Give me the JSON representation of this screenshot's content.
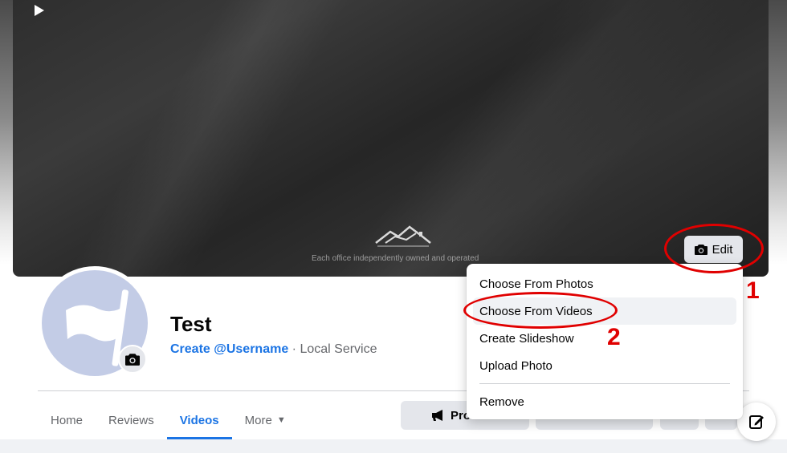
{
  "cover": {
    "caption": "Each office independently owned and operated",
    "edit_label": "Edit"
  },
  "menu": {
    "items": [
      {
        "label": "Choose From Photos"
      },
      {
        "label": "Choose From Videos"
      },
      {
        "label": "Create Slideshow"
      },
      {
        "label": "Upload Photo"
      }
    ],
    "remove_label": "Remove"
  },
  "annotations": {
    "step1": "1",
    "step2": "2",
    "color": "#e00000"
  },
  "profile": {
    "name": "Test",
    "username_link": "Create @Username",
    "separator": " · ",
    "category": "Local Service"
  },
  "tabs": [
    {
      "label": "Home"
    },
    {
      "label": "Reviews"
    },
    {
      "label": "Videos",
      "active": true
    },
    {
      "label": "More"
    }
  ],
  "actions": {
    "promote_label": "Pro"
  },
  "colors": {
    "accent": "#1b74e4",
    "button_bg": "#e4e6eb"
  }
}
